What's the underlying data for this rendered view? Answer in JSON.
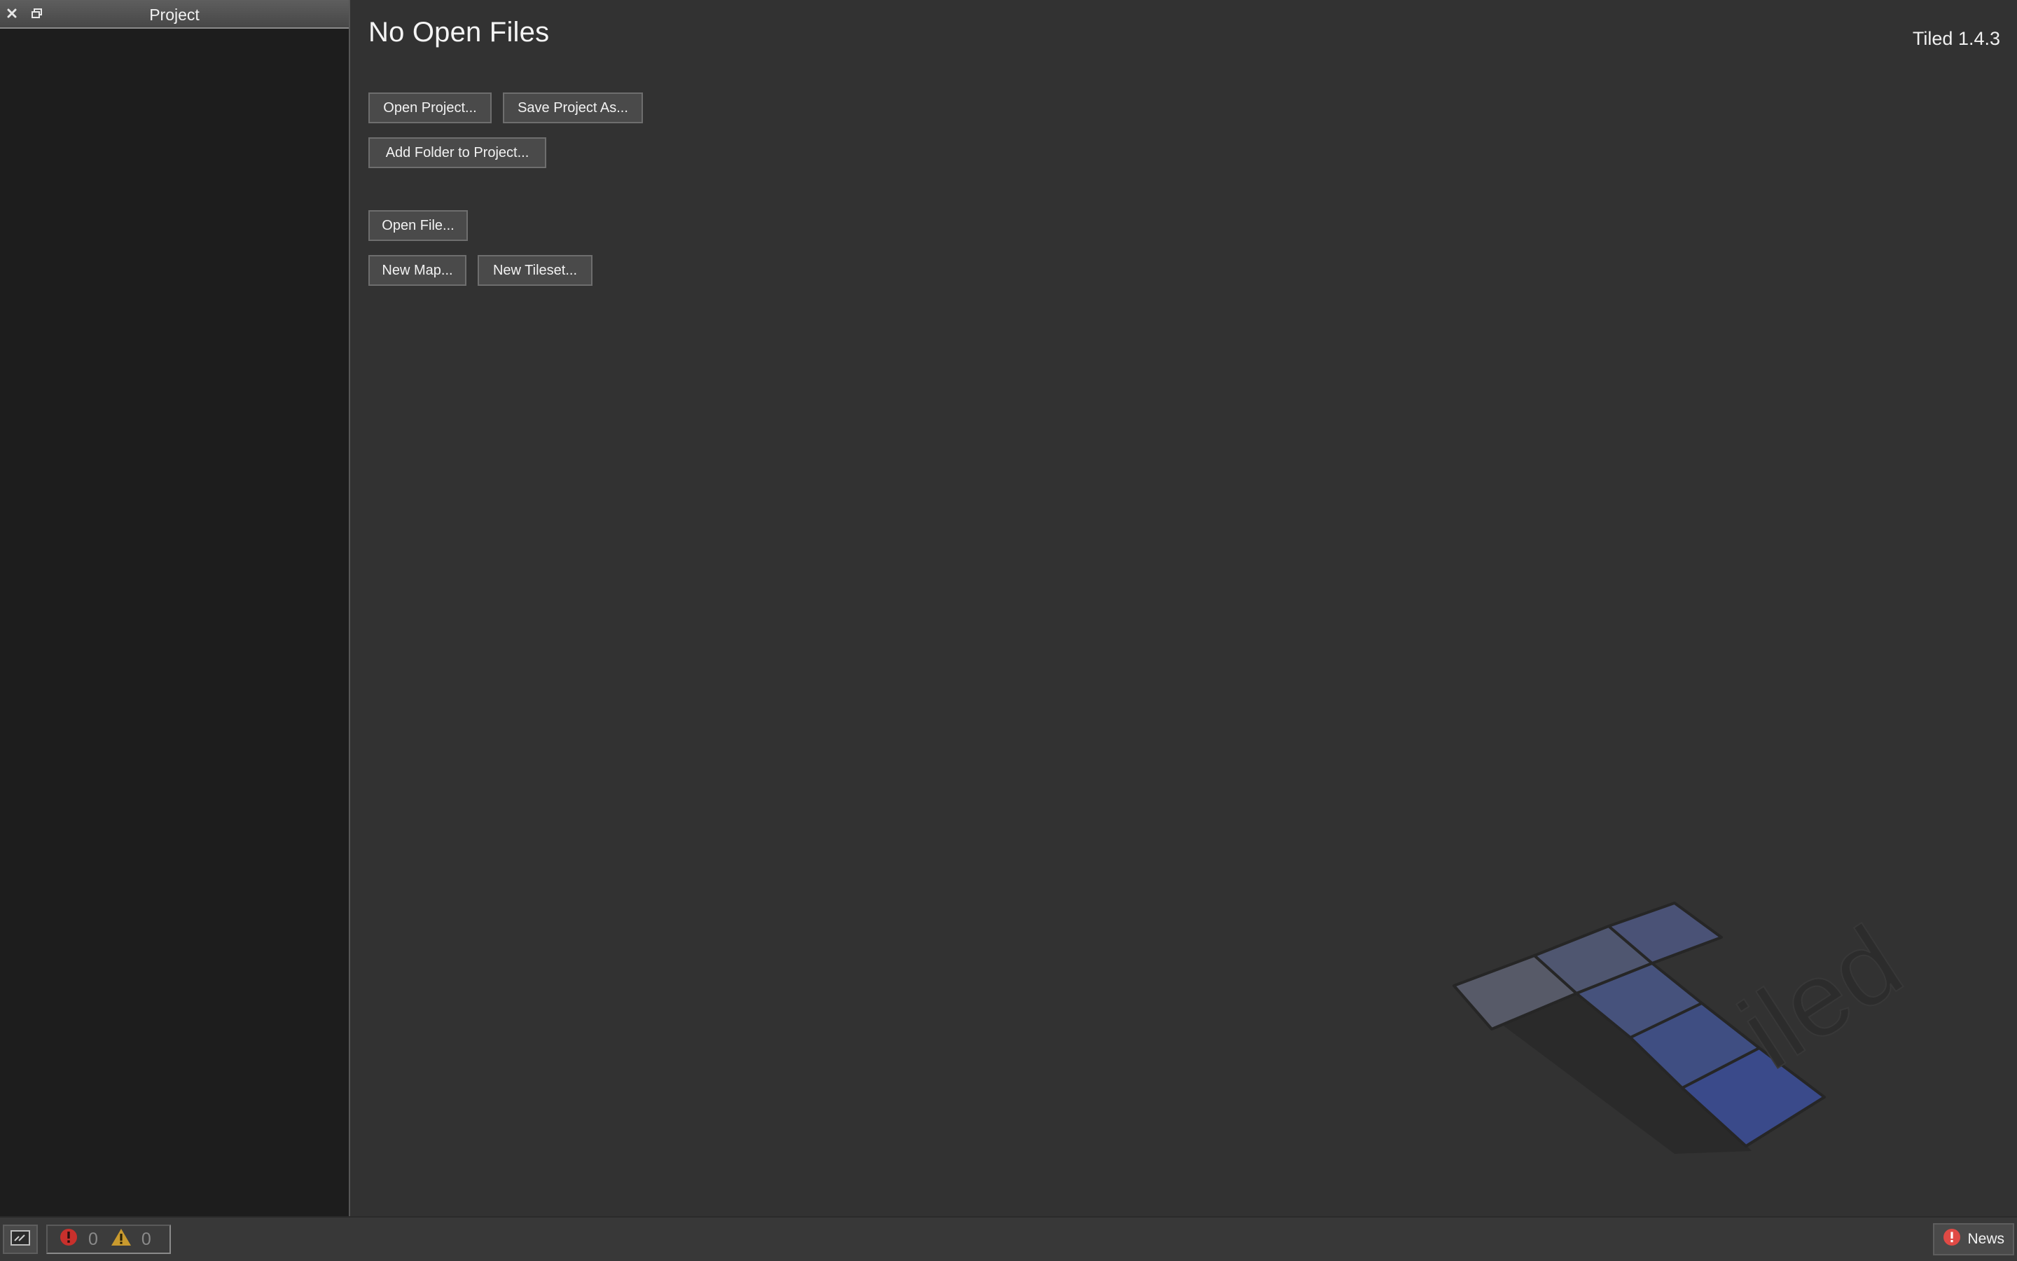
{
  "project_dock": {
    "title": "Project",
    "close_icon": "close-icon",
    "float_icon": "float-window-icon"
  },
  "welcome": {
    "title": "No Open Files",
    "version": "Tiled 1.4.3",
    "buttons": {
      "open_project": "Open Project...",
      "save_project_as": "Save Project As...",
      "add_folder": "Add Folder to Project...",
      "open_file": "Open File...",
      "new_map": "New Map...",
      "new_tileset": "New Tileset..."
    },
    "logo_text": "iled"
  },
  "statusbar": {
    "console_icon": "console-icon",
    "errors_count": "0",
    "warnings_count": "0",
    "news_label": "News"
  },
  "colors": {
    "background": "#323232",
    "dock_background": "#1d1d1d",
    "button_background": "#4a4a4a",
    "error_red": "#c8302c",
    "warning_yellow": "#c99a2e",
    "logo_blue": "#3c4b8a"
  }
}
